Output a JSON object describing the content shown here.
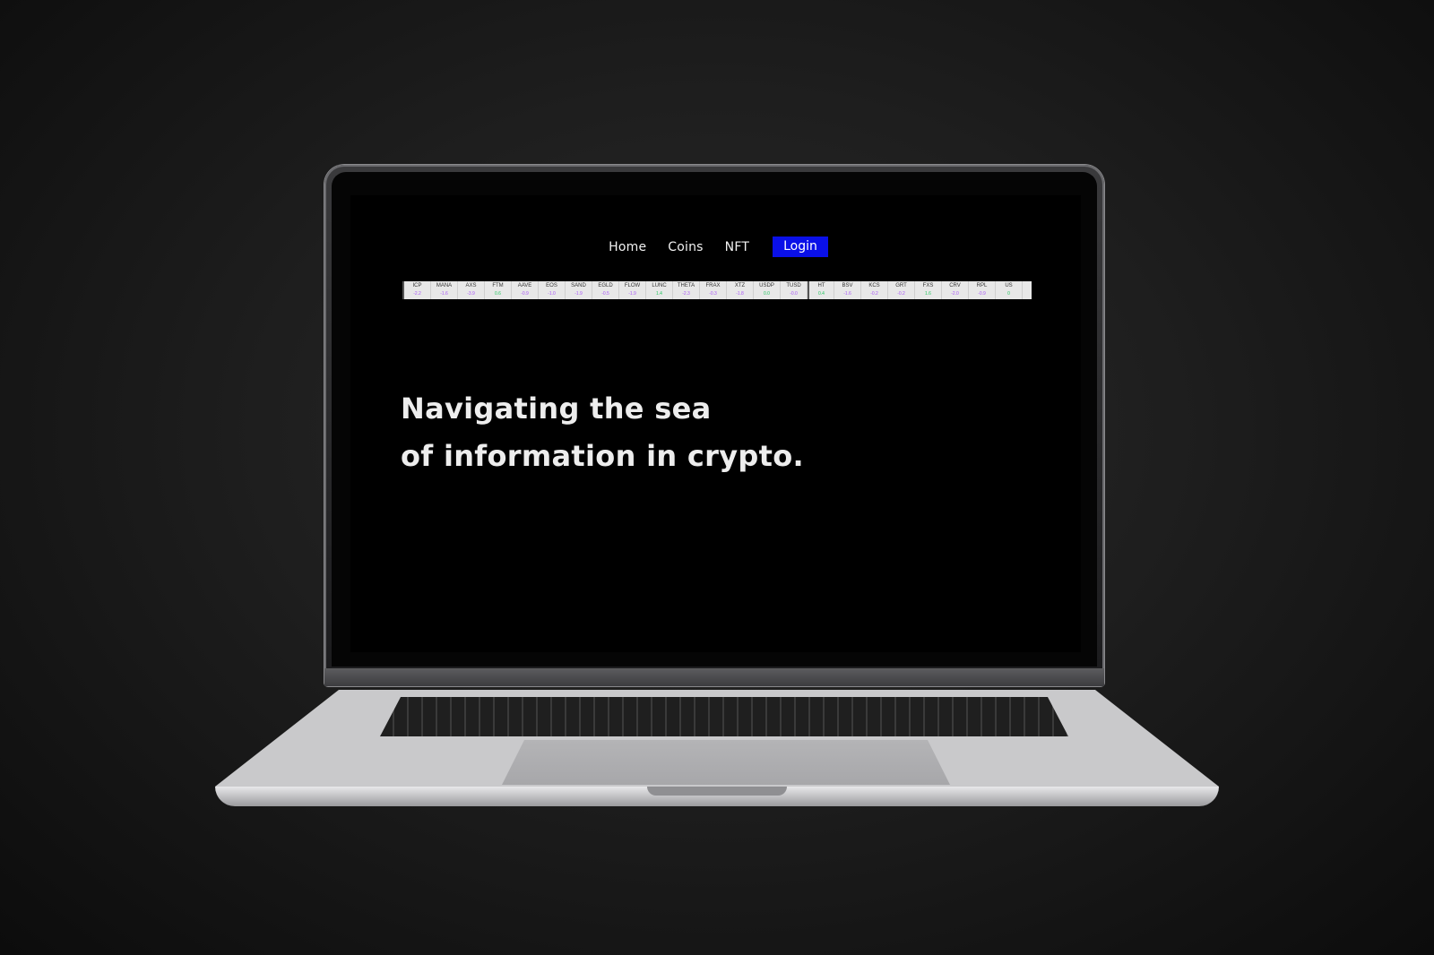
{
  "nav": {
    "items": [
      "Home",
      "Coins",
      "NFT"
    ],
    "login_label": "Login"
  },
  "ticker": [
    {
      "symbol": "ICP",
      "change": "-2.2",
      "dir": "down"
    },
    {
      "symbol": "MANA",
      "change": "-1.6",
      "dir": "down"
    },
    {
      "symbol": "AXS",
      "change": "-3.9",
      "dir": "down"
    },
    {
      "symbol": "FTM",
      "change": "0.6",
      "dir": "up"
    },
    {
      "symbol": "AAVE",
      "change": "-0.9",
      "dir": "down"
    },
    {
      "symbol": "EOS",
      "change": "-1.0",
      "dir": "down"
    },
    {
      "symbol": "SAND",
      "change": "-1.9",
      "dir": "down"
    },
    {
      "symbol": "EGLD",
      "change": "-0.5",
      "dir": "down"
    },
    {
      "symbol": "FLOW",
      "change": "-1.9",
      "dir": "down"
    },
    {
      "symbol": "LUNC",
      "change": "1.4",
      "dir": "up"
    },
    {
      "symbol": "THETA",
      "change": "-2.3",
      "dir": "down"
    },
    {
      "symbol": "FRAX",
      "change": "-0.3",
      "dir": "down"
    },
    {
      "symbol": "XTZ",
      "change": "-1.8",
      "dir": "down"
    },
    {
      "symbol": "USDP",
      "change": "0.0",
      "dir": "up"
    },
    {
      "symbol": "TUSD",
      "change": "-0.0",
      "dir": "down"
    },
    {
      "symbol": "HT",
      "change": "0.4",
      "dir": "up"
    },
    {
      "symbol": "BSV",
      "change": "-1.6",
      "dir": "down"
    },
    {
      "symbol": "KCS",
      "change": "-0.2",
      "dir": "down"
    },
    {
      "symbol": "GRT",
      "change": "-0.2",
      "dir": "down"
    },
    {
      "symbol": "FXS",
      "change": "1.6",
      "dir": "up"
    },
    {
      "symbol": "CRV",
      "change": "-2.0",
      "dir": "down"
    },
    {
      "symbol": "RPL",
      "change": "-0.9",
      "dir": "down"
    },
    {
      "symbol": "US",
      "change": "0",
      "dir": "up"
    }
  ],
  "colors": {
    "accent": "#0a10e8",
    "up": "#22c55e",
    "down": "#a855f7"
  },
  "hero": {
    "line1": "Navigating the sea",
    "line2": "of information in crypto."
  }
}
